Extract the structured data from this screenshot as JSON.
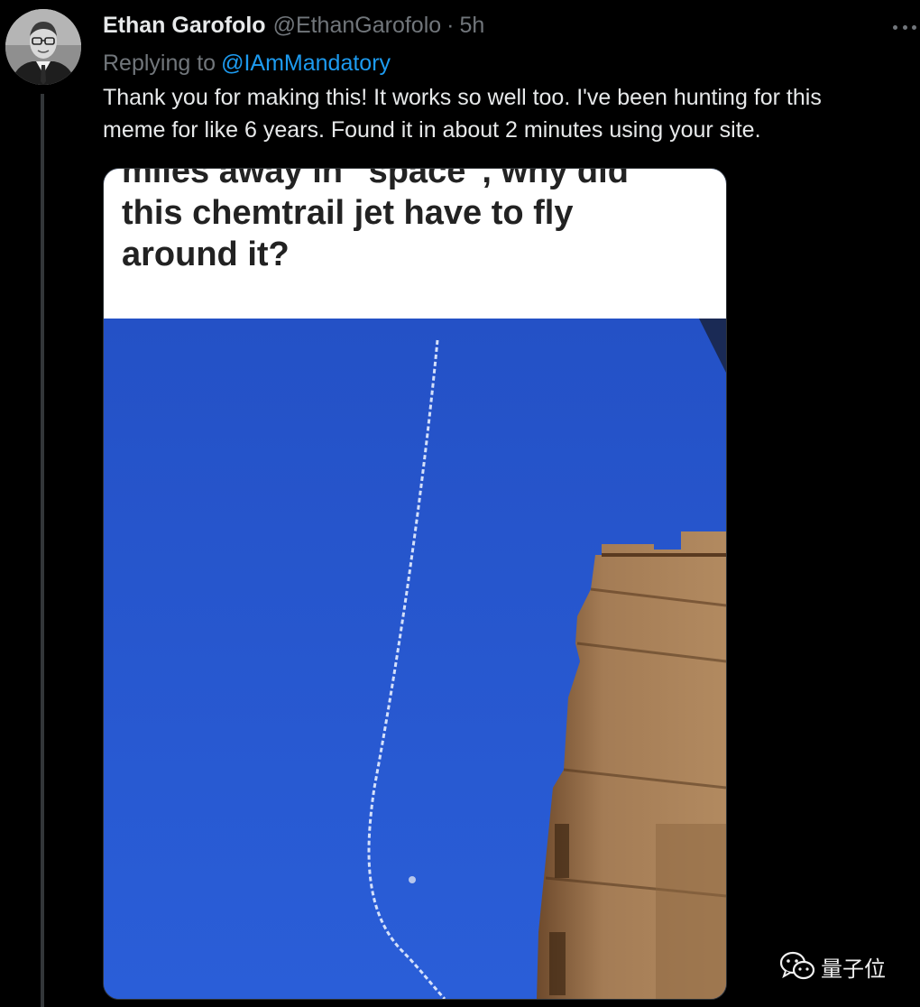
{
  "author": {
    "display_name": "Ethan Garofolo",
    "handle": "@EthanGarofolo",
    "separator": "·",
    "time": "5h",
    "avatar_icon": "profile-photo"
  },
  "replying": {
    "prefix": "Replying to",
    "mention": "@IAmMandatory"
  },
  "tweet": {
    "text": "Thank you for making this!  It works so well too.  I've been hunting for this\nmeme for like 6 years.  Found it in about 2 minutes using your site."
  },
  "media": {
    "caption": "miles away in \"space\", why did\nthis chemtrail jet have to fly\naround it?",
    "sky_color": "#1f4fc4",
    "building_color": "#a07a52"
  },
  "more_menu": {
    "icon": "more-horizontal-icon"
  },
  "watermark": {
    "text": "量子位",
    "icon": "wechat-icon"
  },
  "colors": {
    "background": "#000000",
    "primary_text": "#e7e9ea",
    "secondary_text": "#71767b",
    "link": "#1d9bf0"
  }
}
